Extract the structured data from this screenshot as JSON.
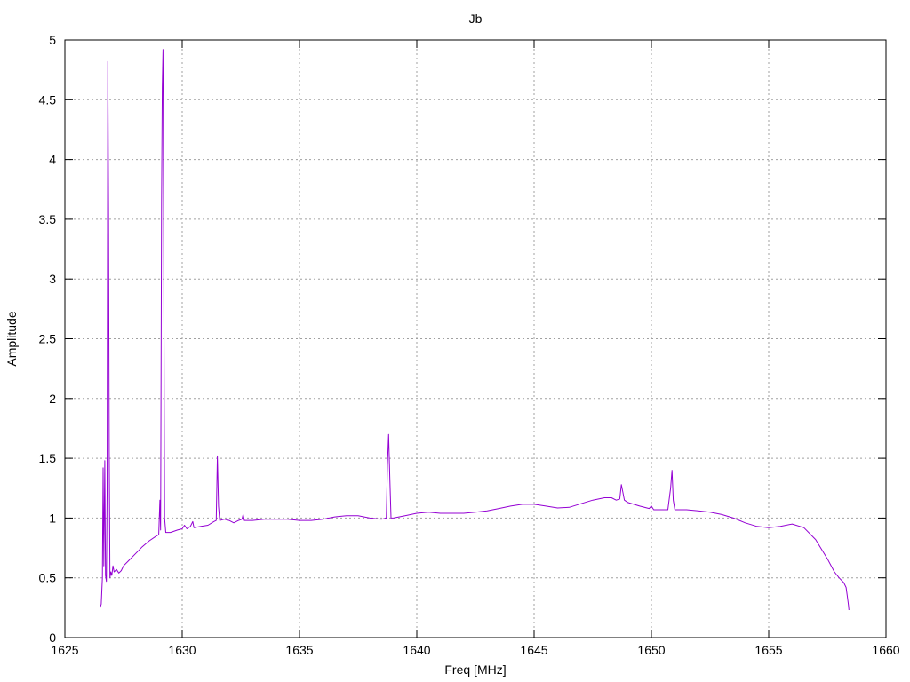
{
  "chart_data": {
    "type": "line",
    "title": "Jb",
    "xlabel": "Freq [MHz]",
    "ylabel": "Amplitude",
    "xlim": [
      1625,
      1660
    ],
    "ylim": [
      0,
      5
    ],
    "xticks": [
      1625,
      1630,
      1635,
      1640,
      1645,
      1650,
      1655,
      1660
    ],
    "yticks": [
      0,
      0.5,
      1,
      1.5,
      2,
      2.5,
      3,
      3.5,
      4,
      4.5,
      5
    ],
    "xtick_labels": [
      "1625",
      "1630",
      "1635",
      "1640",
      "1645",
      "1650",
      "1655",
      "1660"
    ],
    "ytick_labels": [
      "0",
      "0.5",
      "1",
      "1.5",
      "2",
      "2.5",
      "3",
      "3.5",
      "4",
      "4.5",
      "5"
    ],
    "grid": true,
    "legend": "none",
    "series": [
      {
        "color": "#9400d3",
        "points": [
          [
            1626.5,
            0.25
          ],
          [
            1626.55,
            0.28
          ],
          [
            1626.6,
            0.5
          ],
          [
            1626.63,
            1.42
          ],
          [
            1626.66,
            0.6
          ],
          [
            1626.7,
            1.48
          ],
          [
            1626.73,
            0.52
          ],
          [
            1626.77,
            0.47
          ],
          [
            1626.8,
            1.2
          ],
          [
            1626.83,
            4.82
          ],
          [
            1626.86,
            3.6
          ],
          [
            1626.89,
            1.55
          ],
          [
            1626.92,
            0.5
          ],
          [
            1626.96,
            0.55
          ],
          [
            1627.0,
            0.52
          ],
          [
            1627.05,
            0.6
          ],
          [
            1627.1,
            0.55
          ],
          [
            1627.2,
            0.57
          ],
          [
            1627.3,
            0.54
          ],
          [
            1627.4,
            0.56
          ],
          [
            1627.5,
            0.6
          ],
          [
            1627.7,
            0.64
          ],
          [
            1628.0,
            0.7
          ],
          [
            1628.3,
            0.76
          ],
          [
            1628.6,
            0.81
          ],
          [
            1628.9,
            0.85
          ],
          [
            1629.0,
            0.86
          ],
          [
            1629.05,
            1.15
          ],
          [
            1629.08,
            0.9
          ],
          [
            1629.12,
            3.65
          ],
          [
            1629.15,
            4.6
          ],
          [
            1629.18,
            4.92
          ],
          [
            1629.21,
            3.5
          ],
          [
            1629.25,
            1.0
          ],
          [
            1629.3,
            0.88
          ],
          [
            1629.5,
            0.88
          ],
          [
            1629.8,
            0.9
          ],
          [
            1630.0,
            0.91
          ],
          [
            1630.1,
            0.94
          ],
          [
            1630.2,
            0.91
          ],
          [
            1630.35,
            0.93
          ],
          [
            1630.45,
            0.97
          ],
          [
            1630.5,
            0.92
          ],
          [
            1630.8,
            0.93
          ],
          [
            1631.1,
            0.94
          ],
          [
            1631.35,
            0.97
          ],
          [
            1631.45,
            0.98
          ],
          [
            1631.5,
            1.52
          ],
          [
            1631.55,
            1.1
          ],
          [
            1631.6,
            0.98
          ],
          [
            1631.8,
            0.99
          ],
          [
            1632.0,
            0.98
          ],
          [
            1632.2,
            0.96
          ],
          [
            1632.4,
            0.98
          ],
          [
            1632.55,
            0.99
          ],
          [
            1632.6,
            1.03
          ],
          [
            1632.65,
            0.98
          ],
          [
            1633.0,
            0.98
          ],
          [
            1633.5,
            0.99
          ],
          [
            1634.0,
            0.99
          ],
          [
            1634.5,
            0.99
          ],
          [
            1635.0,
            0.98
          ],
          [
            1635.5,
            0.98
          ],
          [
            1636.0,
            0.99
          ],
          [
            1636.5,
            1.01
          ],
          [
            1637.0,
            1.02
          ],
          [
            1637.5,
            1.02
          ],
          [
            1638.0,
            1.0
          ],
          [
            1638.5,
            0.99
          ],
          [
            1638.7,
            1.0
          ],
          [
            1638.75,
            1.45
          ],
          [
            1638.8,
            1.7
          ],
          [
            1638.85,
            1.35
          ],
          [
            1638.9,
            1.0
          ],
          [
            1639.0,
            1.0
          ],
          [
            1639.5,
            1.02
          ],
          [
            1640.0,
            1.04
          ],
          [
            1640.5,
            1.05
          ],
          [
            1641.0,
            1.04
          ],
          [
            1641.5,
            1.04
          ],
          [
            1642.0,
            1.04
          ],
          [
            1642.5,
            1.05
          ],
          [
            1643.0,
            1.06
          ],
          [
            1643.5,
            1.08
          ],
          [
            1644.0,
            1.1
          ],
          [
            1644.5,
            1.115
          ],
          [
            1645.0,
            1.115
          ],
          [
            1645.5,
            1.1
          ],
          [
            1646.0,
            1.085
          ],
          [
            1646.5,
            1.09
          ],
          [
            1647.0,
            1.12
          ],
          [
            1647.5,
            1.15
          ],
          [
            1648.0,
            1.17
          ],
          [
            1648.3,
            1.17
          ],
          [
            1648.5,
            1.15
          ],
          [
            1648.65,
            1.16
          ],
          [
            1648.72,
            1.28
          ],
          [
            1648.78,
            1.22
          ],
          [
            1648.85,
            1.15
          ],
          [
            1649.0,
            1.13
          ],
          [
            1649.5,
            1.1
          ],
          [
            1649.9,
            1.08
          ],
          [
            1650.0,
            1.1
          ],
          [
            1650.1,
            1.07
          ],
          [
            1650.5,
            1.07
          ],
          [
            1650.7,
            1.07
          ],
          [
            1650.82,
            1.25
          ],
          [
            1650.88,
            1.4
          ],
          [
            1650.93,
            1.15
          ],
          [
            1651.0,
            1.07
          ],
          [
            1651.5,
            1.07
          ],
          [
            1652.0,
            1.06
          ],
          [
            1652.5,
            1.05
          ],
          [
            1653.0,
            1.03
          ],
          [
            1653.5,
            1.0
          ],
          [
            1654.0,
            0.96
          ],
          [
            1654.5,
            0.93
          ],
          [
            1655.0,
            0.92
          ],
          [
            1655.5,
            0.93
          ],
          [
            1656.0,
            0.95
          ],
          [
            1656.5,
            0.92
          ],
          [
            1657.0,
            0.82
          ],
          [
            1657.5,
            0.66
          ],
          [
            1657.8,
            0.55
          ],
          [
            1658.0,
            0.5
          ],
          [
            1658.2,
            0.46
          ],
          [
            1658.3,
            0.42
          ],
          [
            1658.35,
            0.35
          ],
          [
            1658.4,
            0.27
          ],
          [
            1658.42,
            0.23
          ]
        ]
      }
    ]
  }
}
